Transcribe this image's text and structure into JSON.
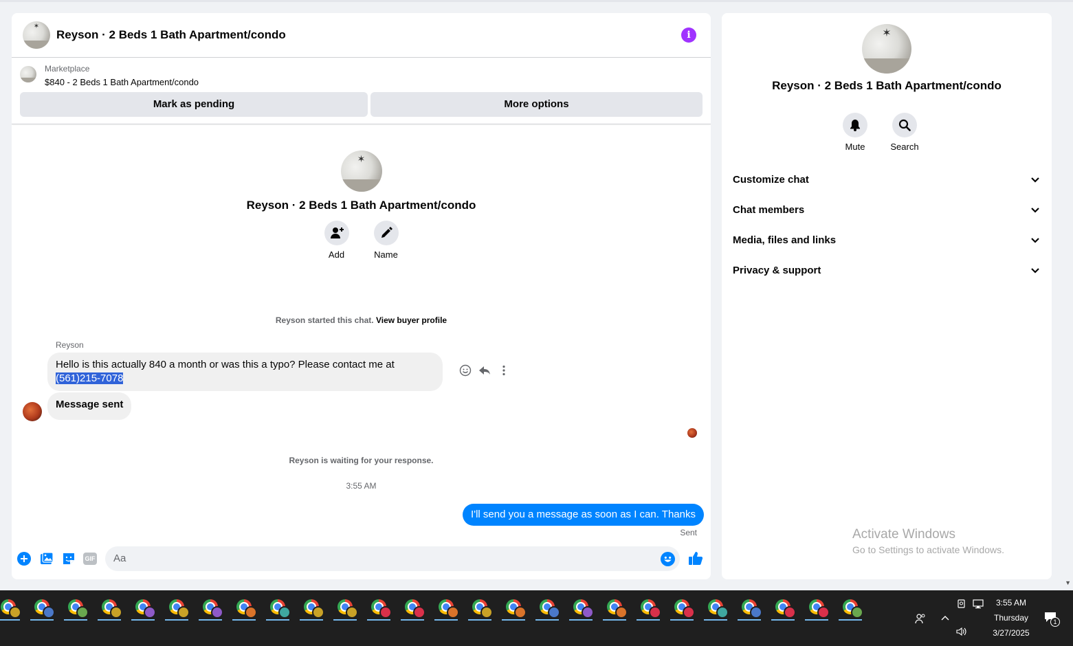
{
  "chat": {
    "title": "Reyson · 2 Beds 1 Bath Apartment/condo",
    "listing": {
      "label": "Marketplace",
      "price_title": "$840 - 2 Beds 1 Bath Apartment/condo",
      "mark_pending_label": "Mark as pending",
      "more_options_label": "More options"
    },
    "profile": {
      "title": "Reyson · 2 Beds 1 Bath Apartment/condo",
      "add_label": "Add",
      "name_label": "Name"
    },
    "started_text": "Reyson started this chat.",
    "view_buyer_profile": "View buyer profile",
    "sender_name": "Reyson",
    "message1_text": "Hello is this actually 840 a month or was this a typo? Please contact me at ",
    "message1_highlight": "(561)215-7078",
    "message2_text": "Message sent",
    "waiting_text": "Reyson is waiting for your response.",
    "timestamp": "3:55 AM",
    "outgoing_text": "I'll send you a message as soon as I can. Thanks",
    "sent_status": "Sent",
    "composer": {
      "placeholder": "Aa",
      "gif_label": "GIF"
    }
  },
  "info_panel": {
    "title": "Reyson · 2 Beds 1 Bath Apartment/condo",
    "mute_label": "Mute",
    "search_label": "Search",
    "sections": [
      "Customize chat",
      "Chat members",
      "Media, files and links",
      "Privacy & support"
    ]
  },
  "watermark": {
    "line1": "Activate Windows",
    "line2": "Go to Settings to activate Windows."
  },
  "taskbar": {
    "app_count": 26,
    "badge_colors": [
      "#c9a227",
      "#4a78c9",
      "#6aa84f",
      "#c9a227",
      "#8e5ac8",
      "#c9a227",
      "#8e5ac8",
      "#d9732a",
      "#3fa7a0",
      "#c9a227",
      "#c9a227",
      "#d9304a",
      "#d9304a",
      "#d9732a",
      "#c9a227",
      "#d9732a",
      "#4a78c9",
      "#8e5ac8",
      "#d9732a",
      "#d9304a",
      "#d9304a",
      "#3fa7a0",
      "#4a78c9",
      "#d9304a",
      "#d9304a",
      "#6aa84f"
    ],
    "time": "3:55 AM",
    "day": "Thursday",
    "date": "3/27/2025",
    "notification_count": "1"
  },
  "colors": {
    "accent_blue": "#0084ff",
    "info_purple": "#a033ff",
    "highlight": "#3063d9"
  }
}
